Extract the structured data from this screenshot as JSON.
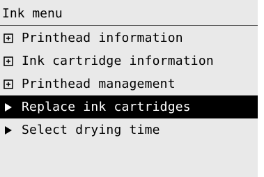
{
  "menu_title": "Ink menu",
  "items": [
    {
      "label": "Printhead information",
      "icon": "expand-box-icon",
      "selected": false
    },
    {
      "label": "Ink cartridge information",
      "icon": "expand-box-icon",
      "selected": false
    },
    {
      "label": "Printhead management",
      "icon": "expand-box-icon",
      "selected": false
    },
    {
      "label": "Replace ink cartridges",
      "icon": "arrow-right-icon",
      "selected": true
    },
    {
      "label": "Select drying time",
      "icon": "arrow-right-icon",
      "selected": false
    }
  ],
  "colors": {
    "screen_background": "#e9e9e9",
    "selected_background": "#000000",
    "selected_text": "#ffffff",
    "text": "#000000"
  }
}
